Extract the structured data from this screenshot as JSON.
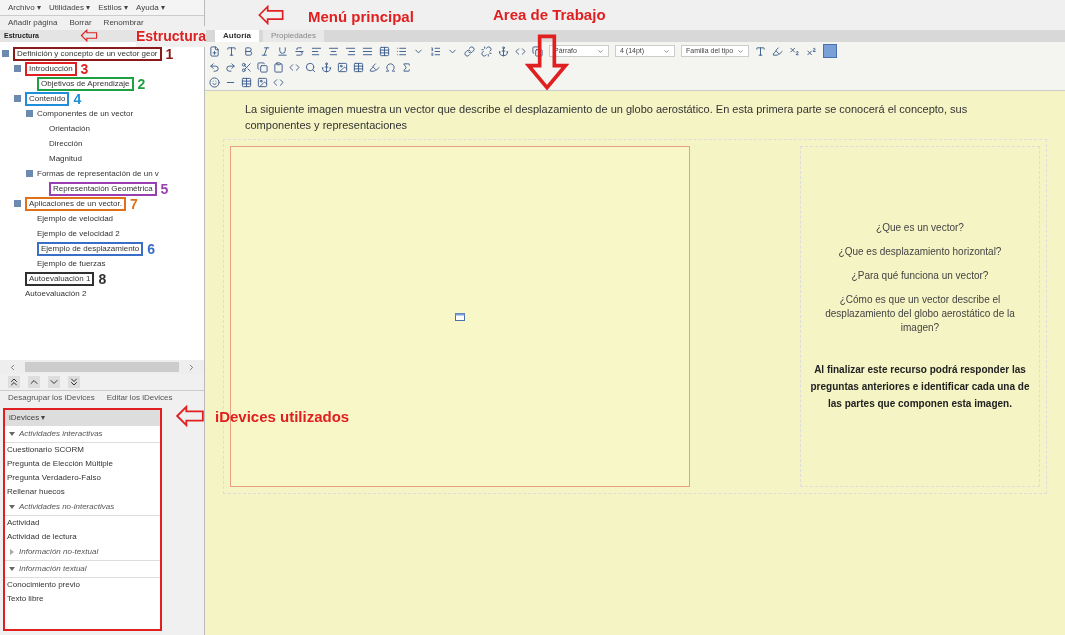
{
  "menu": [
    {
      "label": "Archivo ▾"
    },
    {
      "label": "Utilidades ▾"
    },
    {
      "label": "Estilos ▾"
    },
    {
      "label": "Ayuda ▾"
    }
  ],
  "outline_buttons": [
    "Añadir página",
    "Borrar",
    "Renombrar"
  ],
  "structure": {
    "title": "Estructura",
    "items": [
      {
        "label": "Definición y concepto de un vector geor",
        "expanded": true,
        "mark": {
          "number": "1",
          "color": "#8b1a1a"
        },
        "children": [
          {
            "label": "Introducción",
            "expanded": true,
            "mark": {
              "number": "3",
              "color": "#e02020"
            },
            "children": [
              {
                "label": "Objetivos de Aprendizaje",
                "mark": {
                  "number": "2",
                  "color": "#20a040"
                }
              }
            ]
          },
          {
            "label": "Contenido",
            "expanded": true,
            "mark": {
              "number": "4",
              "color": "#1f8fd8"
            },
            "children": [
              {
                "label": "Componentes de un vector",
                "expanded": true,
                "children": [
                  {
                    "label": "Orientación"
                  },
                  {
                    "label": "Dirección"
                  },
                  {
                    "label": "Magnitud"
                  }
                ]
              },
              {
                "label": "Formas de representación de un v",
                "expanded": true,
                "children": [
                  {
                    "label": "Representación Geométrica",
                    "mark": {
                      "number": "5",
                      "color": "#9a3fb0"
                    }
                  }
                ]
              }
            ]
          },
          {
            "label": "Aplicaciones de un vector.",
            "expanded": true,
            "mark": {
              "number": "7",
              "color": "#e0701a"
            },
            "children": [
              {
                "label": "Ejemplo de velocidad"
              },
              {
                "label": "Ejemplo de velocidad 2"
              },
              {
                "label": "Ejemplo de desplazamiento",
                "mark": {
                  "number": "6",
                  "color": "#3a6fc8"
                }
              },
              {
                "label": "Ejemplo de fuerzas"
              }
            ]
          },
          {
            "label": "Autoevaluación 1",
            "mark": {
              "number": "8",
              "color": "#303030"
            }
          },
          {
            "label": "Autoevaluación 2"
          }
        ]
      }
    ]
  },
  "idevice_buttons": [
    "Desagrupar los iDevices",
    "Editar los iDevices"
  ],
  "idevices": {
    "title": "iDevices ▾",
    "groups": [
      {
        "label": "Actividades interactivas",
        "expanded": true,
        "items": [
          "Cuestionario SCORM",
          "Pregunta de Elección Múltiple",
          "Pregunta Verdadero-Falso",
          "Rellenar huecos"
        ]
      },
      {
        "label": "Actividades no-interactivas",
        "expanded": true,
        "items": [
          "Actividad",
          "Actividad de lectura"
        ]
      },
      {
        "label": "Información no-textual",
        "expanded": false
      },
      {
        "label": "Información textual",
        "expanded": true,
        "items": [
          "Conocimiento previo",
          "Texto libre"
        ]
      }
    ]
  },
  "tabs": [
    {
      "label": "Autoría",
      "selected": true
    },
    {
      "label": "Propiedades",
      "selected": false
    }
  ],
  "editor_selects": [
    {
      "value": "Párrafo"
    },
    {
      "value": "4 (14pt)"
    },
    {
      "value": "Familia del tipo"
    }
  ],
  "intro": "La siguiente imagen muestra un vector que describe el desplazamiento de un globo aerostático. En esta primera parte se conocerá el concepto, sus componentes y representaciones",
  "questions": [
    "¿Que es un vector?",
    "¿Que es desplazamiento horizontal?",
    "¿Para qué funciona un vector?",
    "¿Cómo es que un vector describe el desplazamiento del globo aerostático de la imagen?"
  ],
  "goal": "Al finalizar este recurso podrá responder las preguntas anteriores e identificar cada una de las partes que componen esta imagen.",
  "annotations": [
    {
      "label": "Menú principal"
    },
    {
      "label": "Area de Trabajo"
    },
    {
      "label": "Estructura"
    },
    {
      "label": "iDevices utilizados"
    }
  ]
}
